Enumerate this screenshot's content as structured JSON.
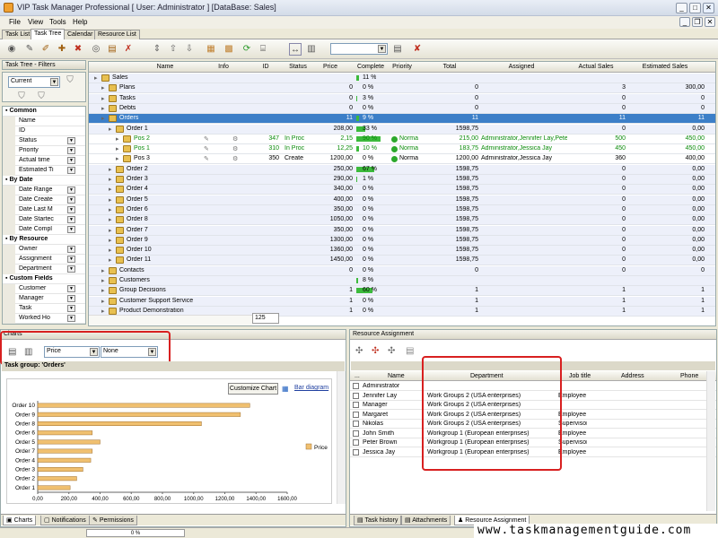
{
  "window": {
    "title": "VIP Task Manager Professional [ User: Administrator ] [DataBase: Sales]"
  },
  "menu": [
    "File",
    "View",
    "Tools",
    "Help"
  ],
  "tabs": [
    "Task List",
    "Task Tree",
    "Calendar",
    "Resource List"
  ],
  "filters": {
    "title": "Task Tree - Filters",
    "view_combo": "Current",
    "groups": [
      {
        "label": "Common",
        "items": [
          [
            "Name",
            false
          ],
          [
            "ID",
            false
          ],
          [
            "Status",
            true
          ],
          [
            "Priority",
            true
          ],
          [
            "Actual time",
            true
          ],
          [
            "Estimated Ti",
            true
          ]
        ]
      },
      {
        "label": "By Date",
        "items": [
          [
            "Date Range",
            true
          ],
          [
            "Date Create",
            true
          ],
          [
            "Date Last M",
            true
          ],
          [
            "Date Startec",
            true
          ],
          [
            "Date Compl",
            true
          ]
        ]
      },
      {
        "label": "By Resource",
        "items": [
          [
            "Owner",
            true
          ],
          [
            "Assignment",
            true
          ],
          [
            "Department",
            true
          ]
        ]
      },
      {
        "label": "Custom Fields",
        "items": [
          [
            "Customer",
            true
          ],
          [
            "Manager",
            true
          ],
          [
            "Task",
            true
          ],
          [
            "Worked Ho",
            true
          ]
        ]
      }
    ]
  },
  "grid": {
    "columns": [
      "Name",
      "Info",
      "ID",
      "Status",
      "Price",
      "Complete",
      "Priority",
      "Total",
      "Assigned",
      "Actual Sales",
      "Estimated Sales"
    ],
    "rows": [
      {
        "level": 0,
        "name": "Sales",
        "price": "",
        "complete": "11 %",
        "pct": 11,
        "total": "",
        "assigned": "",
        "actual": "",
        "est": ""
      },
      {
        "level": 1,
        "name": "Plans",
        "price": "0",
        "complete": "0 %",
        "pct": 0,
        "total": "0",
        "assigned": "",
        "actual": "3",
        "est": "300,00"
      },
      {
        "level": 1,
        "name": "Tasks",
        "price": "0",
        "complete": "3 %",
        "pct": 3,
        "total": "0",
        "assigned": "",
        "actual": "0",
        "est": "0"
      },
      {
        "level": 1,
        "name": "Debts",
        "price": "0",
        "complete": "0 %",
        "pct": 0,
        "total": "0",
        "assigned": "",
        "actual": "0",
        "est": "0"
      },
      {
        "level": 1,
        "name": "Orders",
        "price": "11",
        "complete": "9 %",
        "pct": 9,
        "total": "11",
        "assigned": "",
        "actual": "11",
        "est": "11",
        "selected": true
      },
      {
        "level": 2,
        "name": "Order 1",
        "price": "208,00",
        "complete": "33 %",
        "pct": 33,
        "total": "1598,75",
        "assigned": "",
        "actual": "0",
        "est": "0,00"
      },
      {
        "level": 3,
        "name": "Pos 2",
        "id": "347",
        "status": "In Proc",
        "price": "2,15",
        "complete": "90 %",
        "pct": 90,
        "priority": "Norma",
        "total": "215,00",
        "assigned": "Administrator,Jennifer Lay,Pete",
        "actual": "500",
        "est": "450,00",
        "green": true
      },
      {
        "level": 3,
        "name": "Pos 1",
        "id": "310",
        "status": "In Proc",
        "price": "12,25",
        "complete": "10 %",
        "pct": 10,
        "priority": "Norma",
        "total": "183,75",
        "assigned": "Administrator,Jessica Jay",
        "actual": "450",
        "est": "450,00",
        "green": true
      },
      {
        "level": 3,
        "name": "Pos 3",
        "id": "350",
        "status": "Create",
        "price": "1200,00",
        "complete": "0 %",
        "pct": 0,
        "priority": "Norma",
        "total": "1200,00",
        "assigned": "Administrator,Jessica Jay",
        "actual": "360",
        "est": "400,00"
      },
      {
        "level": 2,
        "name": "Order 2",
        "price": "250,00",
        "complete": "67 %",
        "pct": 67,
        "total": "1598,75",
        "assigned": "",
        "actual": "0",
        "est": "0,00"
      },
      {
        "level": 2,
        "name": "Order 3",
        "price": "290,00",
        "complete": "1 %",
        "pct": 1,
        "total": "1598,75",
        "assigned": "",
        "actual": "0",
        "est": "0,00"
      },
      {
        "level": 2,
        "name": "Order 4",
        "price": "340,00",
        "complete": "0 %",
        "pct": 0,
        "total": "1598,75",
        "assigned": "",
        "actual": "0",
        "est": "0,00"
      },
      {
        "level": 2,
        "name": "Order 5",
        "price": "400,00",
        "complete": "0 %",
        "pct": 0,
        "total": "1598,75",
        "assigned": "",
        "actual": "0",
        "est": "0,00"
      },
      {
        "level": 2,
        "name": "Order 6",
        "price": "350,00",
        "complete": "0 %",
        "pct": 0,
        "total": "1598,75",
        "assigned": "",
        "actual": "0",
        "est": "0,00"
      },
      {
        "level": 2,
        "name": "Order 8",
        "price": "1050,00",
        "complete": "0 %",
        "pct": 0,
        "total": "1598,75",
        "assigned": "",
        "actual": "0",
        "est": "0,00"
      },
      {
        "level": 2,
        "name": "Order 7",
        "price": "350,00",
        "complete": "0 %",
        "pct": 0,
        "total": "1598,75",
        "assigned": "",
        "actual": "0",
        "est": "0,00"
      },
      {
        "level": 2,
        "name": "Order 9",
        "price": "1300,00",
        "complete": "0 %",
        "pct": 0,
        "total": "1598,75",
        "assigned": "",
        "actual": "0",
        "est": "0,00"
      },
      {
        "level": 2,
        "name": "Order 10",
        "price": "1360,00",
        "complete": "0 %",
        "pct": 0,
        "total": "1598,75",
        "assigned": "",
        "actual": "0",
        "est": "0,00"
      },
      {
        "level": 2,
        "name": "Order 11",
        "price": "1450,00",
        "complete": "0 %",
        "pct": 0,
        "total": "1598,75",
        "assigned": "",
        "actual": "0",
        "est": "0,00"
      },
      {
        "level": 1,
        "name": "Contacts",
        "price": "0",
        "complete": "0 %",
        "pct": 0,
        "total": "0",
        "assigned": "",
        "actual": "0",
        "est": "0"
      },
      {
        "level": 1,
        "name": "Customers",
        "price": "",
        "complete": "8 %",
        "pct": 8,
        "total": "",
        "assigned": "",
        "actual": "",
        "est": ""
      },
      {
        "level": 1,
        "name": "Group Decisions",
        "price": "1",
        "complete": "60 %",
        "pct": 60,
        "total": "1",
        "assigned": "",
        "actual": "1",
        "est": "1"
      },
      {
        "level": 1,
        "name": "Customer Support Service",
        "price": "1",
        "complete": "0 %",
        "pct": 0,
        "total": "1",
        "assigned": "",
        "actual": "1",
        "est": "1"
      },
      {
        "level": 1,
        "name": "Product Demonstration",
        "price": "1",
        "complete": "0 %",
        "pct": 0,
        "total": "1",
        "assigned": "",
        "actual": "1",
        "est": "1"
      }
    ],
    "footer_count": "125"
  },
  "charts": {
    "title": "Charts",
    "combo1": "Price",
    "combo2": "None",
    "task_group": "Task group: 'Orders'",
    "customize_button": "Customize Chart",
    "diagram_button": "Bar diagram",
    "bottom_tabs": [
      "Charts",
      "Notifications",
      "Permissions"
    ]
  },
  "chart_data": {
    "type": "bar",
    "orientation": "horizontal",
    "categories": [
      "Order 10",
      "Order 9",
      "Order 8",
      "Order 6",
      "Order 5",
      "Order 7",
      "Order 4",
      "Order 3",
      "Order 2",
      "Order 1"
    ],
    "series": [
      {
        "name": "Price",
        "values": [
          1360,
          1300,
          1050,
          350,
          400,
          350,
          340,
          290,
          250,
          208
        ]
      }
    ],
    "xlim": [
      0,
      1600
    ],
    "xticks": [
      "0,00",
      "200,00",
      "400,00",
      "600,00",
      "800,00",
      "1000,00",
      "1200,00",
      "1400,00",
      "1600,00"
    ],
    "legend": "right",
    "color": "#f0c070"
  },
  "resources": {
    "title": "Resource Assignment",
    "columns": [
      "...",
      "Name",
      "Department",
      "Job title",
      "Address",
      "Phone"
    ],
    "rows": [
      {
        "name": "Administrator",
        "dept": "",
        "job": ""
      },
      {
        "name": "Jennifer Lay",
        "dept": "Work Groups 2 (USA enterprises)",
        "job": "Employee"
      },
      {
        "name": "Manager",
        "dept": "Work Groups 2 (USA enterprises)",
        "job": ""
      },
      {
        "name": "Margaret",
        "dept": "Work Groups 2 (USA enterprises)",
        "job": "Employee"
      },
      {
        "name": "Nikolas",
        "dept": "Work Groups 2 (USA enterprises)",
        "job": "Supervisor"
      },
      {
        "name": "John Smith",
        "dept": "Workgroup 1 (European enterprises)",
        "job": "Employee"
      },
      {
        "name": "Peter Brown",
        "dept": "Workgroup 1 (European enterprises)",
        "job": "Supervisor"
      },
      {
        "name": "Jessica Jay",
        "dept": "Workgroup 1 (European enterprises)",
        "job": "Employee"
      }
    ],
    "bottom_tabs": [
      "Task history",
      "Attachments",
      "Resource Assignment"
    ]
  },
  "status": {
    "progress": "0 %"
  },
  "watermark": "www.taskmanagementguide.com"
}
